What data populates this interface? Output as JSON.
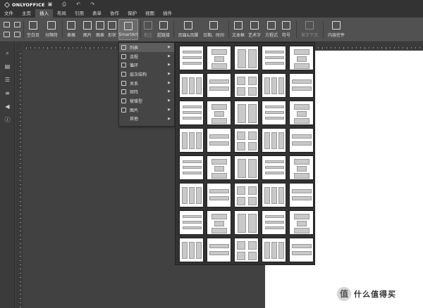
{
  "app": {
    "logo_text": "ONLYOFFICE",
    "quick_access": [
      {
        "name": "save-icon",
        "glyph": "▣"
      },
      {
        "name": "print-icon",
        "glyph": "⎙"
      },
      {
        "name": "undo-icon",
        "glyph": "↶"
      },
      {
        "name": "redo-icon",
        "glyph": "↷"
      }
    ]
  },
  "menu_tabs": [
    "文件",
    "主页",
    "插入",
    "布局",
    "引用",
    "表单",
    "协作",
    "保护",
    "视图",
    "插件"
  ],
  "active_tab_index": 2,
  "toolbar": {
    "buttons": [
      {
        "key": "blank-page",
        "label": "空白页",
        "icon": "blank-page-icon",
        "disabled": false
      },
      {
        "key": "page-break",
        "label": "分隔符",
        "icon": "page-break-icon",
        "disabled": false
      },
      {
        "key": "table",
        "label": "表格",
        "icon": "table-icon",
        "disabled": false
      },
      {
        "key": "image",
        "label": "图片",
        "icon": "image-icon",
        "disabled": false
      },
      {
        "key": "chart",
        "label": "图表",
        "icon": "chart-icon",
        "disabled": false
      },
      {
        "key": "shape",
        "label": "形状",
        "icon": "shape-icon",
        "disabled": false
      },
      {
        "key": "smartart",
        "label": "SmartArt",
        "icon": "smartart-icon",
        "disabled": false
      },
      {
        "key": "comment",
        "label": "批注",
        "icon": "comment-icon",
        "disabled": true
      },
      {
        "key": "hyperlink",
        "label": "超链接",
        "icon": "hyperlink-icon",
        "disabled": false
      },
      {
        "key": "header-footer",
        "label": "页眉&页脚",
        "icon": "header-footer-icon",
        "disabled": false
      },
      {
        "key": "datetime",
        "label": "日期、时间",
        "icon": "datetime-icon",
        "disabled": false
      },
      {
        "key": "textbox",
        "label": "文本框",
        "icon": "textbox-icon",
        "disabled": false
      },
      {
        "key": "textart",
        "label": "艺术字",
        "icon": "textart-icon",
        "disabled": false
      },
      {
        "key": "equation",
        "label": "方程式",
        "icon": "equation-icon",
        "disabled": false
      },
      {
        "key": "symbol",
        "label": "符号",
        "icon": "symbol-icon",
        "disabled": false
      },
      {
        "key": "dropcap",
        "label": "首字下沉",
        "icon": "dropcap-icon",
        "disabled": true
      },
      {
        "key": "content-control",
        "label": "内容控件",
        "icon": "content-control-icon",
        "disabled": false
      }
    ]
  },
  "smartart_menu": {
    "items": [
      {
        "label": "列表",
        "icon": "list-icon",
        "selected": true,
        "has_submenu": true
      },
      {
        "label": "流程",
        "icon": "process-icon",
        "selected": false,
        "has_submenu": true
      },
      {
        "label": "循环",
        "icon": "cycle-icon",
        "selected": false,
        "has_submenu": true
      },
      {
        "label": "层次结构",
        "icon": "hierarchy-icon",
        "selected": false,
        "has_submenu": true
      },
      {
        "label": "关系",
        "icon": "relationship-icon",
        "selected": false,
        "has_submenu": true
      },
      {
        "label": "矩阵",
        "icon": "matrix-icon",
        "selected": false,
        "has_submenu": true
      },
      {
        "label": "棱锥型",
        "icon": "pyramid-icon",
        "selected": false,
        "has_submenu": true
      },
      {
        "label": "图片",
        "icon": "picture-icon",
        "selected": false,
        "has_submenu": true
      },
      {
        "label": "其他",
        "icon": "",
        "selected": false,
        "has_submenu": true
      }
    ]
  },
  "gallery": {
    "rows": 8,
    "cols": 5
  },
  "left_panel_icons": [
    "search-icon",
    "comments-icon",
    "navigation-icon",
    "headings-icon",
    "speaker-icon",
    "info-icon"
  ],
  "watermark": {
    "logo_glyph": "值",
    "text": "什么值得买"
  },
  "colors": {
    "accent": "#ffffff",
    "toolbar": "#515151",
    "canvas": "#414141",
    "page": "#ffffff"
  }
}
